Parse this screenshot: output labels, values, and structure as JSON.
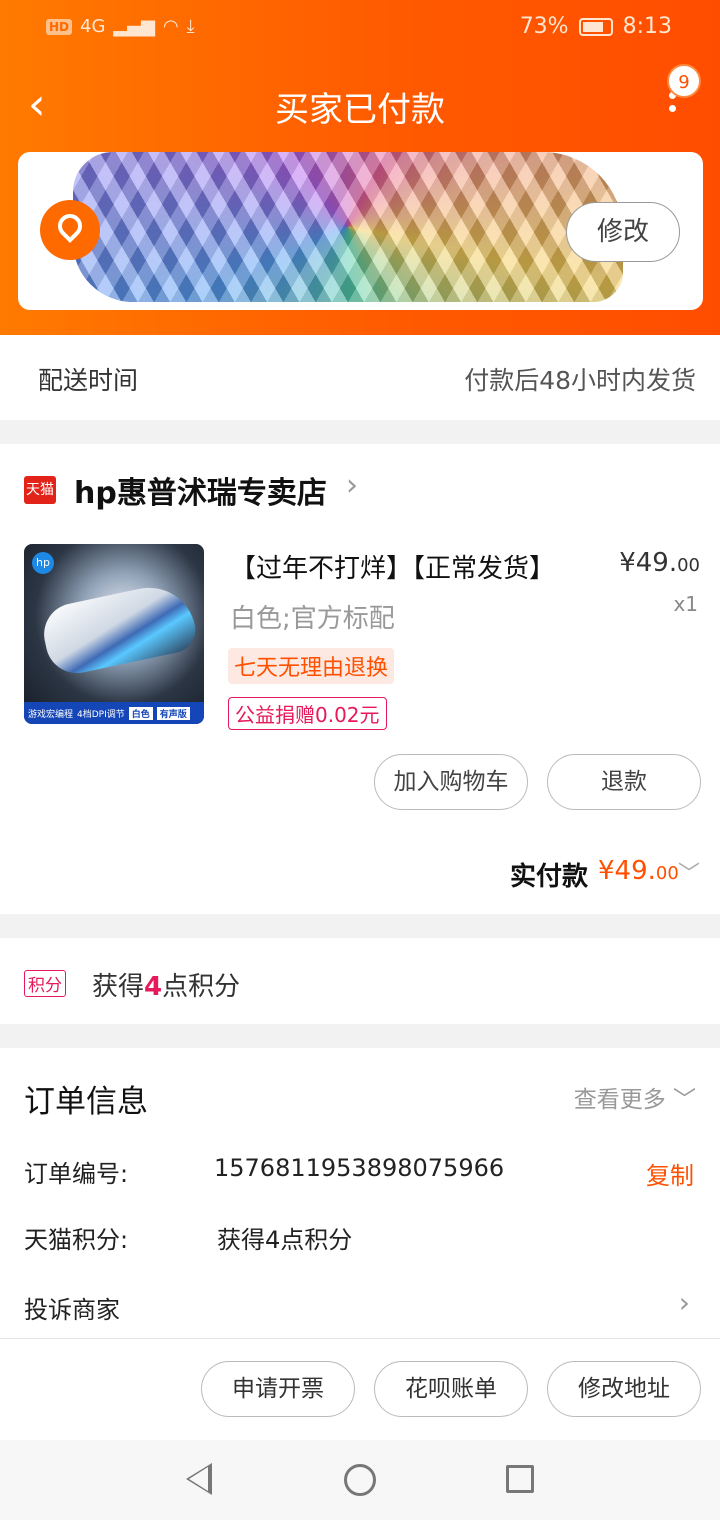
{
  "status_bar": {
    "network": "4G",
    "hd": "HD",
    "battery": "73%",
    "time": "8:13"
  },
  "header": {
    "title": "买家已付款",
    "back_icon": "‹",
    "badge_count": "9"
  },
  "address": {
    "edit_label": "修改"
  },
  "delivery": {
    "label": "配送时间",
    "value": "付款后48小时内发货"
  },
  "store": {
    "platform_badge": "天猫",
    "name": "hp惠普沭瑞专卖店",
    "chevron": "›"
  },
  "product": {
    "title": "【过年不打烊】【正常发货】",
    "price_main": "¥49.",
    "price_cents": "00",
    "sku": "白色;官方标配",
    "quantity": "x1",
    "tag_return": "七天无理由退换",
    "tag_charity": "公益捐赠0.02元",
    "image_brand": "hp",
    "image_strip": [
      "游戏宏编程",
      "4档DPI调节",
      "白色",
      "有声版"
    ]
  },
  "actions": {
    "add_cart": "加入购物车",
    "refund": "退款"
  },
  "paid": {
    "label": "实付款",
    "value_main": "¥49.",
    "value_cents": "00"
  },
  "points": {
    "badge": "积分",
    "prefix": "获得",
    "number": "4",
    "suffix": "点积分"
  },
  "order": {
    "title": "订单信息",
    "more": "查看更多",
    "number_label": "订单编号:",
    "number_value": "1576811953898075966",
    "copy_label": "复制",
    "tmall_points_label": "天猫积分:",
    "tmall_points_value": "获得4点积分",
    "complaint_label": "投诉商家"
  },
  "bottom": {
    "invoice": "申请开票",
    "huabei": "花呗账单",
    "modify_address": "修改地址"
  },
  "colors": {
    "brand_orange": "#ff5000",
    "tmall_red": "#e2231a",
    "charity_red": "#e6195a"
  }
}
